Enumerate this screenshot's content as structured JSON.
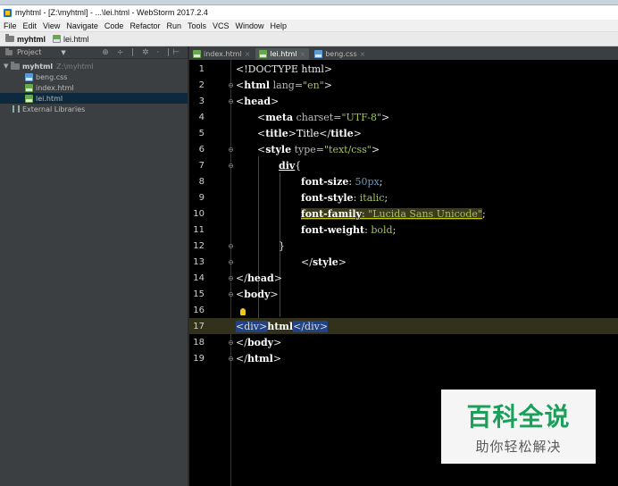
{
  "window": {
    "title": "myhtml - [Z:\\myhtml] - ...\\lei.html - WebStorm 2017.2.4"
  },
  "menu": [
    "File",
    "Edit",
    "View",
    "Navigate",
    "Code",
    "Refactor",
    "Run",
    "Tools",
    "VCS",
    "Window",
    "Help"
  ],
  "breadcrumb": [
    "myhtml",
    "lei.html"
  ],
  "project": {
    "header_label": "Project",
    "tree": [
      {
        "label": "myhtml",
        "path": "Z:\\myhtml"
      },
      {
        "label": "beng.css"
      },
      {
        "label": "index.html"
      },
      {
        "label": "lei.html"
      },
      {
        "label": "External Libraries"
      }
    ]
  },
  "tabs": [
    {
      "label": "index.html"
    },
    {
      "label": "lei.html"
    },
    {
      "label": "beng.css"
    }
  ],
  "line_numbers": [
    "1",
    "2",
    "3",
    "4",
    "5",
    "6",
    "7",
    "8",
    "9",
    "10",
    "11",
    "12",
    "13",
    "14",
    "15",
    "16",
    "17",
    "18",
    "19"
  ],
  "code": {
    "doctype": "<!DOCTYPE html>",
    "html_lang_attr": "lang=",
    "html_lang_val": "\"en\"",
    "meta_charset_attr": "charset=",
    "meta_charset_val": "\"UTF-8\"",
    "title_text": "Title",
    "style_type_attr": "type=",
    "style_type_val": "\"text/css\"",
    "selector": "div",
    "prop1_name": "font-size",
    "prop1_val": "50px",
    "prop2_name": "font-style",
    "prop2_val": "italic",
    "prop3_name": "font-family",
    "prop3_val": "\"Lucida Sans Unicode\"",
    "prop4_name": "font-weight",
    "prop4_val": "bold",
    "body_text": "html"
  },
  "watermark": {
    "title": "百科全说",
    "subtitle": "助你轻松解决"
  }
}
